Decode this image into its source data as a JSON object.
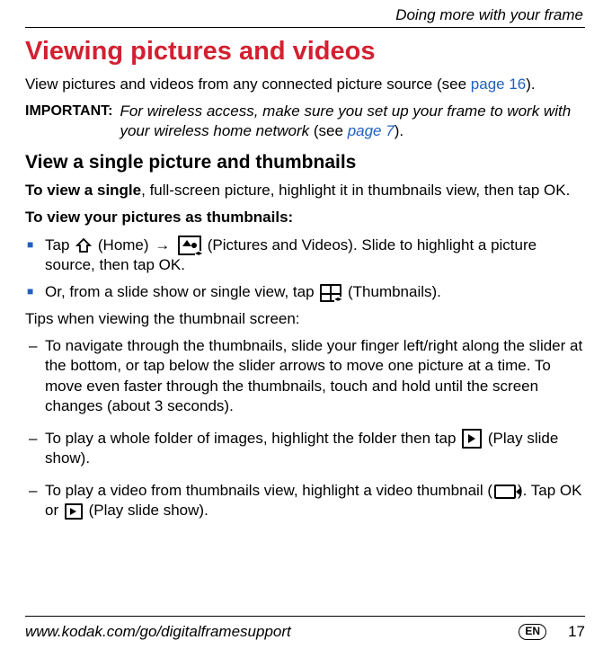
{
  "header": "Doing more with your frame",
  "title": "Viewing pictures and videos",
  "intro": {
    "pre": "View pictures and videos from any connected picture source (see ",
    "link": "page 16",
    "post": ")."
  },
  "important": {
    "label": "IMPORTANT:",
    "body_pre": "For wireless access, make sure you set up your frame to work with your wireless home network ",
    "see_open": "(see ",
    "see_link": "page 7",
    "see_close": ")."
  },
  "subtitle": "View a single picture and thumbnails",
  "single": {
    "lead": "To view a single",
    "rest": ", full-screen picture, highlight it in thumbnails view, then tap OK."
  },
  "thumb_heading": "To view your pictures as thumbnails:",
  "bullets": {
    "a_pre": "Tap ",
    "a_home": "(Home)",
    "a_arrow": "→",
    "a_pv": "(Pictures and Videos). Slide to highlight a picture source, then tap OK.",
    "b_pre": "Or, from a slide show or single view, tap ",
    "b_thumb": "(Thumbnails)."
  },
  "tips_lead": "Tips when viewing the thumbnail screen:",
  "tips": {
    "a": "To navigate through the thumbnails, slide your finger left/right along the slider at the bottom, or tap below the slider arrows to move one picture at a time. To move even faster through the thumbnails, touch and hold until the screen changes (about 3 seconds).",
    "b_pre": "To play a whole folder of images, highlight the folder then tap ",
    "b_post": "(Play slide show).",
    "c_pre": "To play a video from thumbnails view, highlight a video thumbnail (",
    "c_mid": "). Tap OK or ",
    "c_post": "(Play slide show)."
  },
  "footer": {
    "url": "www.kodak.com/go/digitalframesupport",
    "lang": "EN",
    "page": "17"
  }
}
